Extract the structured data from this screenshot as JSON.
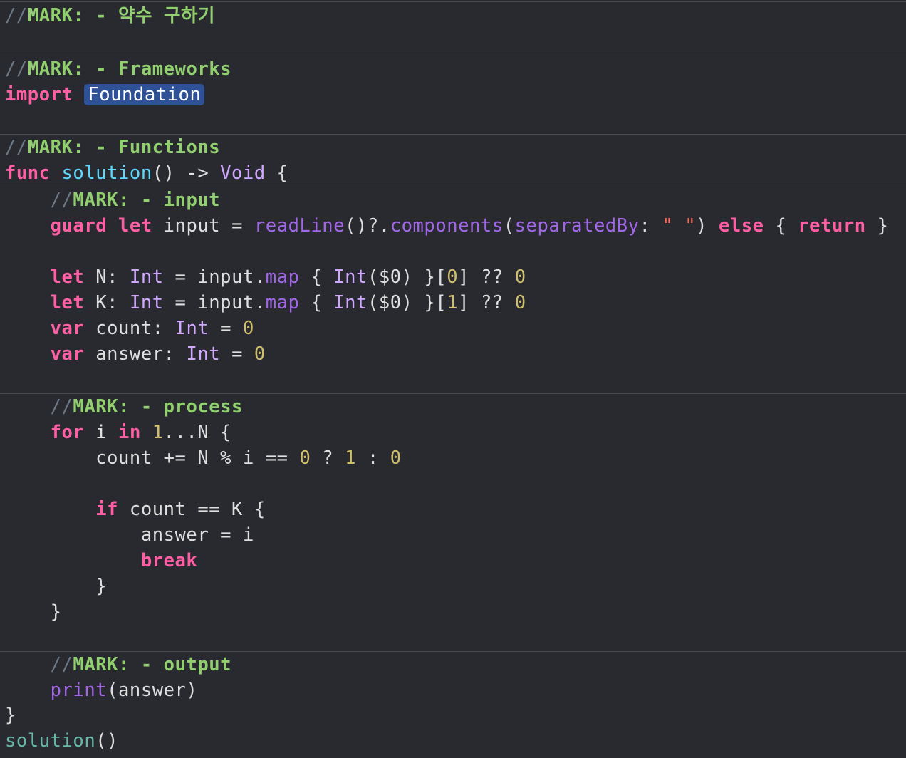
{
  "window": {
    "background": "#292a30"
  },
  "colors": {
    "keyword": "#fc5fa3",
    "type": "#d0a8ff",
    "call": "#a167e6",
    "function_decl": "#5dd8ff",
    "function_call": "#67b7a4",
    "number": "#d0bf69",
    "string": "#fc6a5d",
    "comment": "#6c7986",
    "mark": "#92d06f",
    "plain": "#dfdfe0",
    "selection": "#2f5196"
  },
  "code": {
    "mark_title": {
      "slashes": "//",
      "text": "MARK: - 약수 구하기"
    },
    "mark_frameworks": {
      "slashes": "//",
      "text": "MARK: - Frameworks"
    },
    "import_line": {
      "keyword": "import",
      "module": "Foundation"
    },
    "mark_functions": {
      "slashes": "//",
      "text": "MARK: - Functions"
    },
    "func_decl": {
      "keyword": "func",
      "name": "solution",
      "params": "() -> ",
      "return_type": "Void",
      "open": " {"
    },
    "mark_input": {
      "slashes": "//",
      "text": "MARK: - input"
    },
    "guard_line": {
      "kw_guard": "guard",
      "kw_let": "let",
      "var_name": "input",
      "eq": " = ",
      "readline": "readLine",
      "paren": "()?.",
      "components": "components",
      "open": "(",
      "label": "separatedBy",
      "colon": ": ",
      "string": "\" \"",
      "close": ") ",
      "kw_else": "else",
      "brace_open": " { ",
      "kw_return": "return",
      "brace_close": " }"
    },
    "let_n": {
      "kw": "let",
      "name": " N: ",
      "type": "Int",
      "eq": " = input.",
      "map": "map",
      "open": " { ",
      "int": "Int",
      "arg": "($0) }[",
      "idx": "0",
      "rest": "] ?? ",
      "default": "0"
    },
    "let_k": {
      "kw": "let",
      "name": " K: ",
      "type": "Int",
      "eq": " = input.",
      "map": "map",
      "open": " { ",
      "int": "Int",
      "arg": "($0) }[",
      "idx": "1",
      "rest": "] ?? ",
      "default": "0"
    },
    "var_count": {
      "kw": "var",
      "name": " count: ",
      "type": "Int",
      "eq": " = ",
      "value": "0"
    },
    "var_answer": {
      "kw": "var",
      "name": " answer: ",
      "type": "Int",
      "eq": " = ",
      "value": "0"
    },
    "mark_process": {
      "slashes": "//",
      "text": "MARK: - process"
    },
    "for_line": {
      "kw_for": "for",
      "var": " i ",
      "kw_in": "in",
      "sp": " ",
      "start": "1",
      "range": "...N {"
    },
    "count_line": {
      "text1": "count += N % i == ",
      "zero": "0",
      "q": " ? ",
      "one": "1",
      "c": " : ",
      "zero2": "0"
    },
    "if_line": {
      "kw_if": "if",
      "rest": " count == K {"
    },
    "answer_line": {
      "text": "answer = i"
    },
    "break_line": {
      "kw": "break"
    },
    "close_if": {
      "text": "}"
    },
    "close_for": {
      "text": "}"
    },
    "mark_output": {
      "slashes": "//",
      "text": "MARK: - output"
    },
    "print_line": {
      "fn": "print",
      "rest": "(answer)"
    },
    "close_func": {
      "text": "}"
    },
    "call_line": {
      "fn": "solution",
      "rest": "()"
    }
  }
}
